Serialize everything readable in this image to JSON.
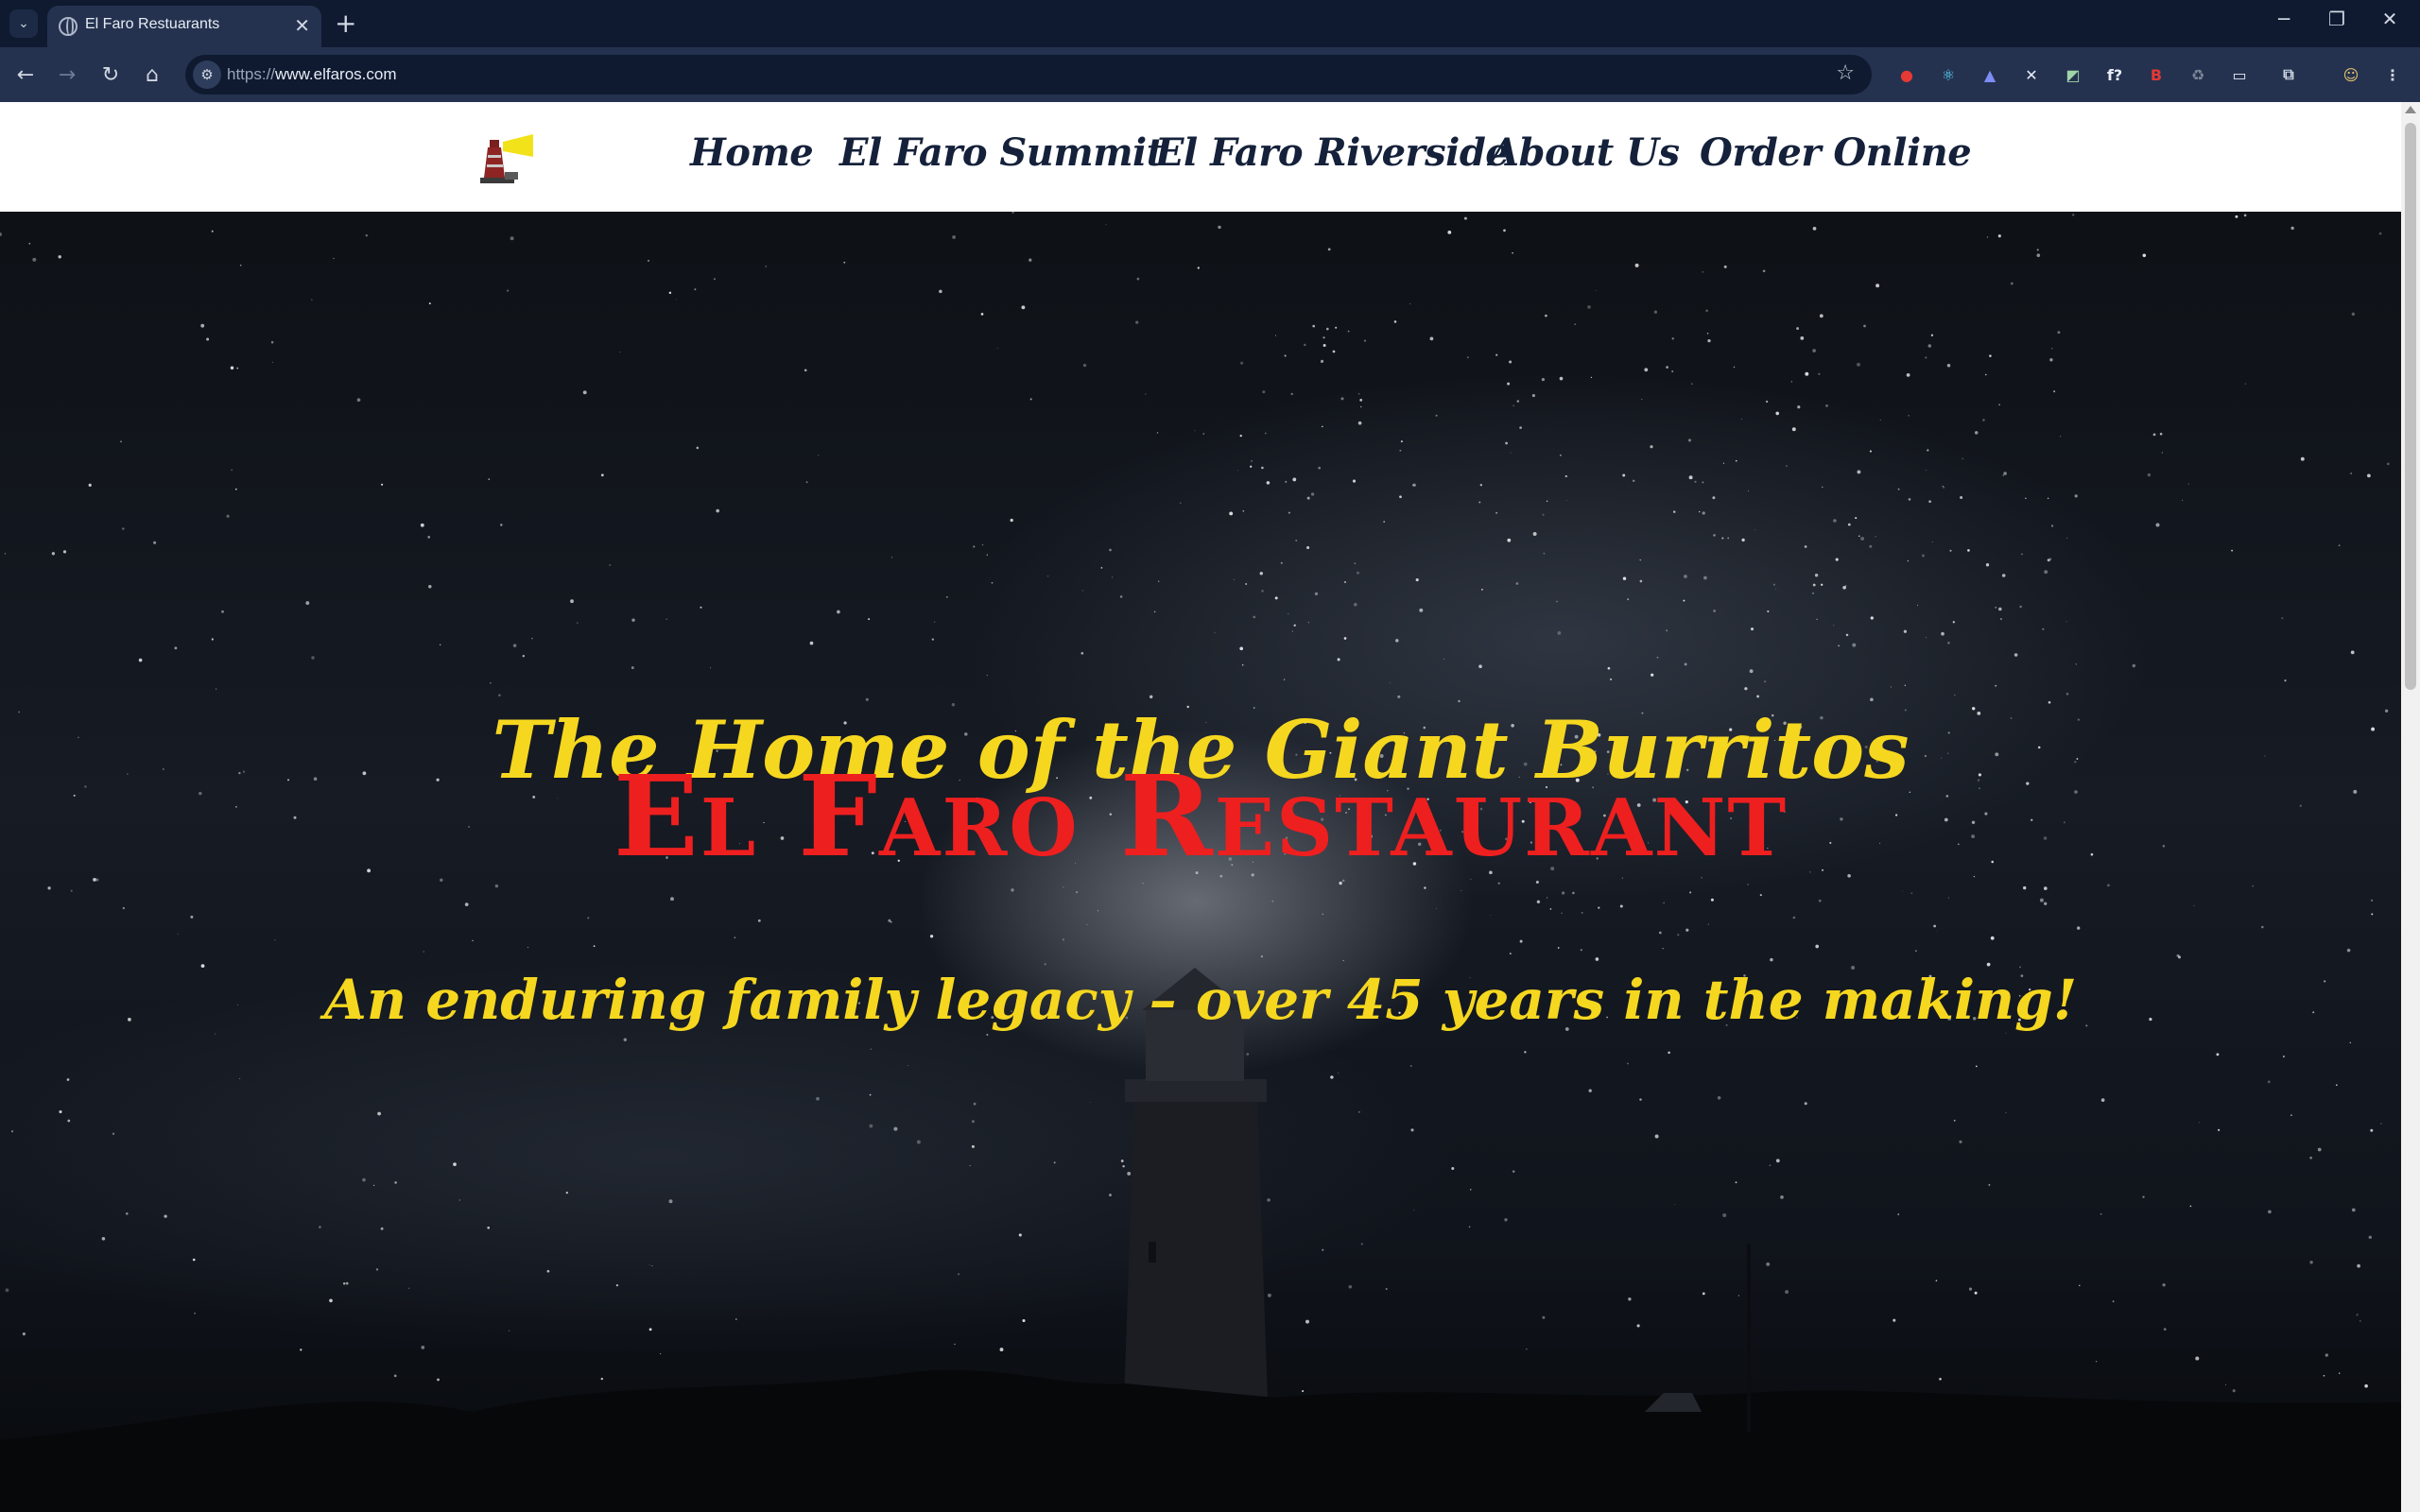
{
  "browser": {
    "tab_title": "El Faro Restuarants",
    "tab_close": "✕",
    "new_tab": "+",
    "url_scheme": "https://",
    "url_host": "www.elfaros.com",
    "window_controls": {
      "minimize": "─",
      "restore": "❐",
      "close": "✕"
    },
    "nav_icons": {
      "back": "←",
      "forward": "→",
      "reload": "↻",
      "home": "⌂",
      "tab_menu": "⌄",
      "site_info": "⚙",
      "bookmark": "☆"
    },
    "extensions": [
      {
        "name": "red-shield-extension-icon",
        "glyph": "●",
        "color": "#e53935"
      },
      {
        "name": "react-devtools-extension-icon",
        "glyph": "⚛",
        "color": "#61dafb"
      },
      {
        "name": "triangle-extension-icon",
        "glyph": "▲",
        "color": "#7e8cf5"
      },
      {
        "name": "arrows-extension-icon",
        "glyph": "✕",
        "color": "#e7ecf5"
      },
      {
        "name": "image-extension-icon",
        "glyph": "◩",
        "color": "#9fd3a8"
      },
      {
        "name": "font-extension-icon",
        "glyph": "f?",
        "color": "#e7ecf5"
      },
      {
        "name": "red-b-extension-icon",
        "glyph": "B",
        "color": "#e53935"
      },
      {
        "name": "recycle-extension-icon",
        "glyph": "♻",
        "color": "#7d8799"
      },
      {
        "name": "screen-extension-icon",
        "glyph": "▭",
        "color": "#e7ecf5"
      },
      {
        "name": "puzzle-extensions-icon",
        "glyph": "⧉",
        "color": "#d0d6e2"
      },
      {
        "name": "profile-avatar-icon",
        "glyph": "☺",
        "color": "#e8c46a"
      },
      {
        "name": "more-menu-icon",
        "glyph": "⋮",
        "color": "#d0d6e2"
      }
    ]
  },
  "site": {
    "nav": [
      "Home",
      "El Faro Summit",
      "El Faro Riverside",
      "About Us",
      "Order Online"
    ],
    "hero": {
      "tagline_top": "The Home of the Giant Burritos",
      "headline": "El Faro Restaurant",
      "tagline_bottom": "An enduring family legacy – over 45 years in the making!"
    },
    "colors": {
      "tagline": "#f6d71f",
      "headline": "#ee1f1f",
      "nav_text": "#15213a",
      "header_bg": "#ffffff"
    }
  }
}
